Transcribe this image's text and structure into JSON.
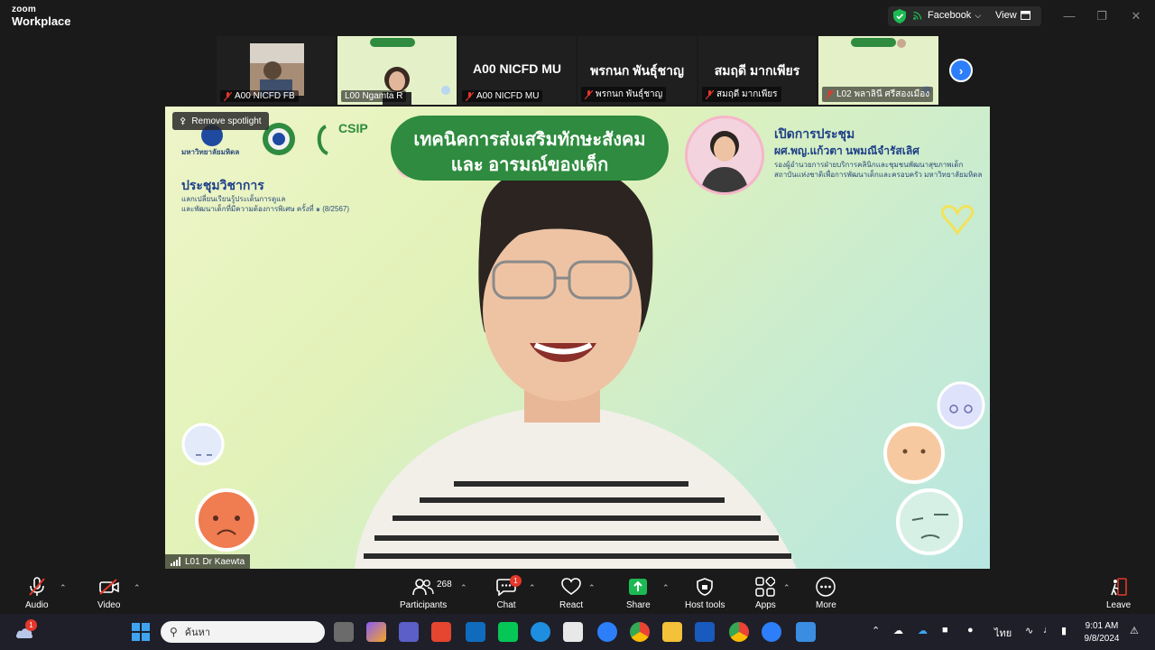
{
  "titlebar": {
    "brand_top": "zoom",
    "brand_bottom": "Workplace",
    "facebook_label": "Facebook",
    "view_label": "View"
  },
  "thumbnails": [
    {
      "name": "A00 NICFD FB"
    },
    {
      "name": "L00 Ngamta R"
    },
    {
      "name": "A00 NICFD MU",
      "big": "A00 NICFD MU"
    },
    {
      "name": "พรกนก พันธุ์ชาญ",
      "big": "พรกนก พันธุ์ชาญ"
    },
    {
      "name": "สมฤดี มากเพียร",
      "big": "สมฤดี มากเพียร"
    },
    {
      "name": "L02 พลาลินี ศรีสองเมือง"
    }
  ],
  "stage": {
    "spotlight_label": "Remove spotlight",
    "title_line1": "เทคนิคการส่งเสริมทักษะสังคม",
    "title_line2": "และ อารมณ์ของเด็ก",
    "csip": "CSIP",
    "univ_name": "มหาวิทยาลัยมหิดล",
    "seminar_title": "ประชุมวิชาการ",
    "seminar_sub1": "แลกเปลี่ยนเรียนรู้ประเด็นการดูแล",
    "seminar_sub2": "และพัฒนาเด็กที่มีความต้องการพิเศษ ครั้งที่ ๑ (8/2567)",
    "open_title": "เปิดการประชุม",
    "speaker_name": "ผศ.พญ.แก้วตา นพมณีจำรัสเลิศ",
    "speaker_role1": "รองผู้อำนวยการฝ่ายบริการคลินิกและชุมชนพัฒนาสุขภาพเด็ก",
    "speaker_role2": "สถาบันแห่งชาติเพื่อการพัฒนาเด็กและครอบครัว มหาวิทยาลัยมหิดล",
    "participant_name": "L01 Dr Kaewta"
  },
  "toolbar": {
    "audio": "Audio",
    "video": "Video",
    "participants": "Participants",
    "participants_count": "268",
    "chat": "Chat",
    "chat_badge": "1",
    "react": "React",
    "share": "Share",
    "host_tools": "Host tools",
    "apps": "Apps",
    "more": "More",
    "leave": "Leave"
  },
  "taskbar": {
    "search_placeholder": "ค้นหา",
    "weather_badge": "1",
    "lang": "ไทย",
    "time": "9:01 AM",
    "date": "9/8/2024"
  },
  "colors": {
    "zoom_blue": "#2d7ff9",
    "share_green": "#1db954",
    "title_green": "#2e8b3f",
    "leave_red": "#e5372b"
  }
}
